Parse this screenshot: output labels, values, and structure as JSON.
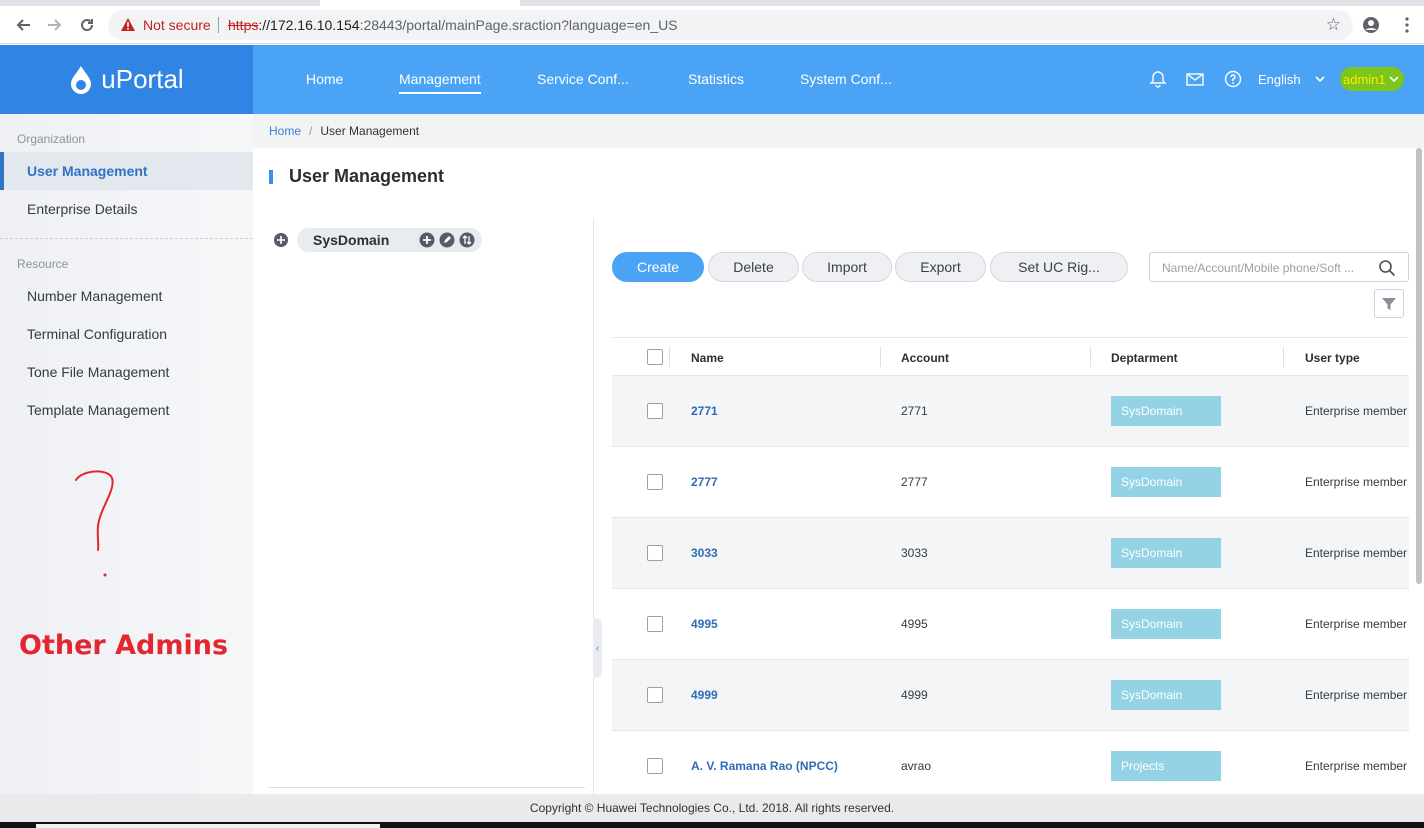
{
  "browser": {
    "not_secure": "Not secure",
    "url_scheme": "https",
    "url_host": "://172.16.10.154",
    "url_rest": ":28443/portal/mainPage.sraction?language=en_US"
  },
  "app": {
    "logo": "uPortal",
    "nav": [
      "Home",
      "Management",
      "Service Conf...",
      "Statistics",
      "System Conf..."
    ],
    "active_nav": "Management",
    "language": "English",
    "user": "admin1",
    "colors": {
      "header": "#4aa3f5",
      "logo_bg": "#2f84e4",
      "user_highlight": "#7cc61c"
    }
  },
  "sidebar": {
    "group1": "Organization",
    "items1": [
      "User Management",
      "Enterprise Details"
    ],
    "group2": "Resource",
    "items2": [
      "Number Management",
      "Terminal Configuration",
      "Tone File Management",
      "Template Management"
    ],
    "annotation_mark": "?",
    "annotation_text": "Other Admins"
  },
  "breadcrumb": {
    "home": "Home",
    "separator": "/",
    "current": "User Management"
  },
  "page": {
    "title": "User Management"
  },
  "tree": {
    "root": "SysDomain"
  },
  "actions": {
    "create": "Create",
    "delete": "Delete",
    "import": "Import",
    "export": "Export",
    "set_uc": "Set UC Rig..."
  },
  "search": {
    "placeholder": "Name/Account/Mobile phone/Soft ..."
  },
  "table": {
    "headers": [
      "Name",
      "Account",
      "Deptarment",
      "User type"
    ],
    "rows": [
      {
        "name": "2771",
        "account": "2771",
        "dept": "SysDomain",
        "type": "Enterprise member"
      },
      {
        "name": "2777",
        "account": "2777",
        "dept": "SysDomain",
        "type": "Enterprise member"
      },
      {
        "name": "3033",
        "account": "3033",
        "dept": "SysDomain",
        "type": "Enterprise member"
      },
      {
        "name": "4995",
        "account": "4995",
        "dept": "SysDomain",
        "type": "Enterprise member"
      },
      {
        "name": "4999",
        "account": "4999",
        "dept": "SysDomain",
        "type": "Enterprise member"
      },
      {
        "name": "A. V. Ramana Rao (NPCC)",
        "account": "avrao",
        "dept": "Projects",
        "type": "Enterprise member"
      }
    ]
  },
  "footer": {
    "copyright": "Copyright © Huawei Technologies Co., Ltd. 2018. All rights reserved."
  }
}
